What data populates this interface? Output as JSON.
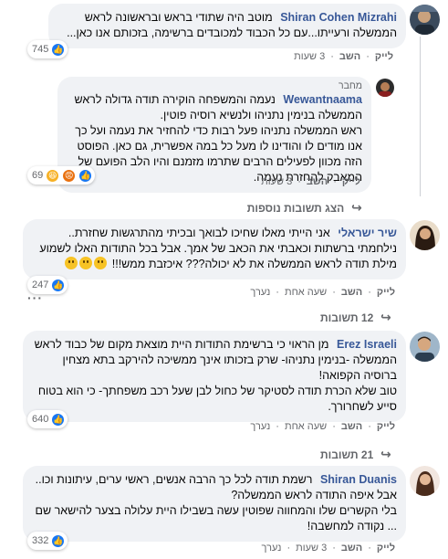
{
  "comments": [
    {
      "name": "Shiran Cohen Mizrahi",
      "text": "מוטב היה שתודי בראש ובראשונה לראש הממשלה ורעייתו...עם כל הכבוד למכובדים ברשימה, בזכותם אנו כאן...",
      "reactions": "745",
      "actions": [
        "לייק",
        "השב",
        "3 שעות"
      ]
    },
    {
      "role": "מחבר",
      "name": "Wewantnaama",
      "text": "נעמה והמשפחה הוקירה תודה גדולה לראש הממשלה בנימין נתניהו ולנשיא רוסיה פוטין.\nראש הממשלה נתניהו פעל רבות כדי להחזיר את נעמה ועל כך אנו מודים לו והודינו לו מעל כל במה אפשרית, גם כאן. הפוסט הזה מכוון לפעילים הרבים שתרמו מזמנם והיו הלב הפועם של המאבק להחזרת נעמה.",
      "reactions": "69",
      "actions": [
        "לייק",
        "השב",
        "3 שעות"
      ],
      "more_replies": "הצג תשובות נוספות"
    },
    {
      "name": "שיר ישראלי",
      "text": "אני הייתי מאלו שחיכו לבואך ובכיתי מהתרגשות שחזרת.. נילחמתי ברשתות וכאבתי את הכאב של אמך. אבל בכל התודות האלו לשמוע מילת תודה לראש הממשלה את לא יכולה??? איכזבת ממש!!!",
      "reactions": "247",
      "actions": [
        "לייק",
        "השב",
        "שעה אחת",
        "נערך"
      ],
      "replies": "12 תשובות"
    },
    {
      "name": "Erez Israeli",
      "text": "מן הראוי כי ברשימת התודות היית מוצאת מקום של כבוד לראש הממשלה -בנימין נתניהו- שרק בזכותו אינך ממשיכה להירקב בתא מצחין ברוסיה הקפואה!\nטוב שלא הכרת תודה לסטיקר של כחול לבן שעל רכב משפחתך- כי הוא בטוח סייע לשחרורך.",
      "reactions": "640",
      "actions": [
        "לייק",
        "השב",
        "שעה אחת",
        "נערך"
      ],
      "replies": "21 תשובות"
    },
    {
      "name": "Shiran Duanis",
      "text": "רשמת תודה לכל כך הרבה אנשים, ראשי ערים, עיתונות וכו.. אבל איפה התודה לראש הממשלה?\nבלי הקשרים שלו והמחווה שפוטין עשה בשבילו היית עלולה בצער להישאר שם ... נקודה למחשבה!",
      "reactions": "332",
      "actions": [
        "לייק",
        "השב",
        "3 שעות",
        "נערך"
      ]
    }
  ],
  "colors": {
    "like": "#1877f2",
    "name": "#385898",
    "bubble": "#f0f2f5",
    "meta": "#65676b"
  },
  "icons": {
    "like": "like-icon",
    "haha": "haha-icon",
    "angry": "angry-icon",
    "reply_arrow": "reply-arrow-icon",
    "more": "more-options-icon"
  }
}
